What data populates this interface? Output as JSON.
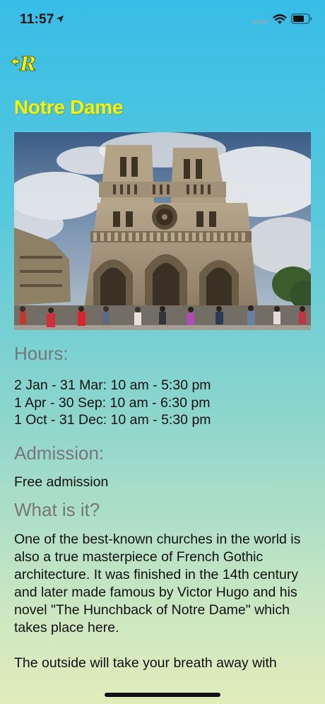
{
  "status_bar": {
    "time": "11:57",
    "icons": [
      "location-arrow-icon",
      "cellular-signal-icon",
      "wifi-icon",
      "battery-icon"
    ]
  },
  "nav": {
    "back_logo_letter": "R",
    "logo_color": "#f2f20a"
  },
  "place": {
    "title": "Notre Dame",
    "title_color": "#f2f20a",
    "image_alt": "Notre Dame cathedral facade"
  },
  "hours": {
    "heading": "Hours:",
    "lines": [
      "2 Jan - 31 Mar: 10 am - 5:30 pm",
      "1 Apr - 30 Sep: 10 am - 6:30 pm",
      "1 Oct - 31 Dec: 10 am - 5:30 pm"
    ]
  },
  "admission": {
    "heading": "Admission:",
    "text": "Free admission"
  },
  "about": {
    "heading": "What is it?",
    "paragraphs": [
      "One of the best-known churches in the world is also a true masterpiece of French Gothic architecture. It was finished in the 14th century and later made famous by Victor Hugo and his novel \"The Hunchback of Notre Dame\" which takes place here.",
      "The outside will take your breath away with"
    ]
  },
  "colors": {
    "gradient_top": "#37bde6",
    "gradient_bottom": "#e3ecbb",
    "heading_gray": "#777777"
  }
}
